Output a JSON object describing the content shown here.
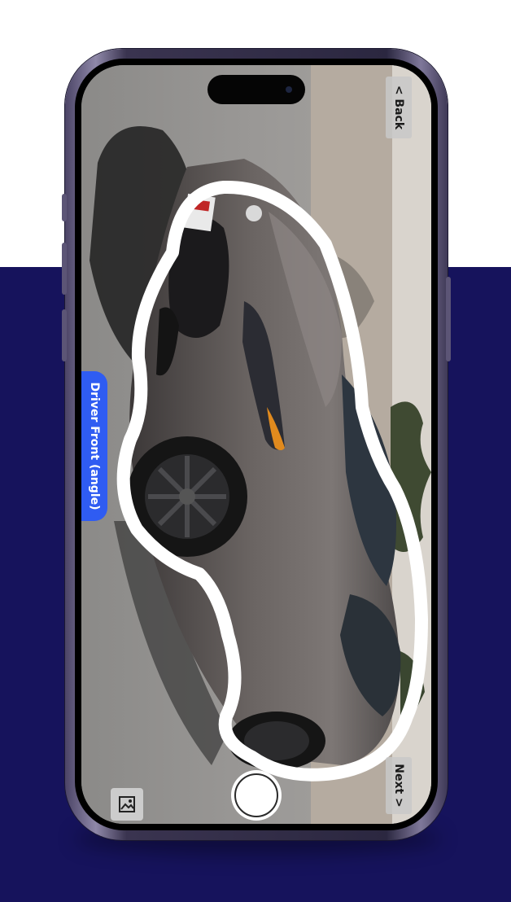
{
  "colors": {
    "background_top": "#ffffff",
    "background_bottom": "#16135c",
    "accent": "#2f5cf2",
    "outline": "#ffffff"
  },
  "camera": {
    "back_label": "< Back",
    "next_label": "Next >",
    "angle_label": "Driver Front (angle)",
    "shutter_icon": "shutter-icon",
    "gallery_icon": "image-gallery-icon"
  }
}
